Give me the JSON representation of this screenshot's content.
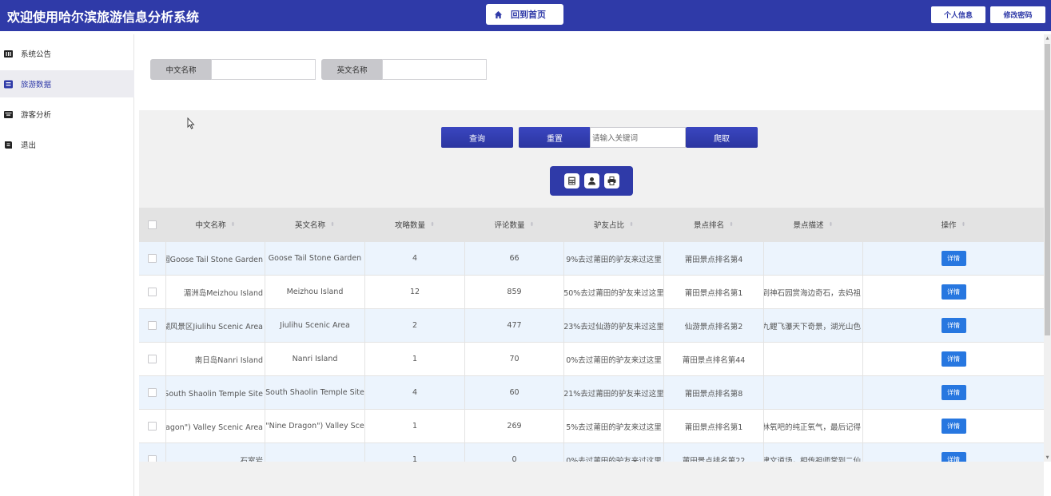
{
  "header": {
    "title": "欢迎使用哈尔滨旅游信息分析系统",
    "home_label": "回到首页",
    "profile_label": "个人信息",
    "password_label": "修改密码",
    "bg_color": "#2f3aa8"
  },
  "sidebar": {
    "items": [
      {
        "label": "系统公告",
        "icon": "notice-icon",
        "active": false
      },
      {
        "label": "旅游数据",
        "icon": "data-icon",
        "active": true
      },
      {
        "label": "游客分析",
        "icon": "analysis-icon",
        "active": false
      },
      {
        "label": "退出",
        "icon": "logout-icon",
        "active": false
      }
    ]
  },
  "search": {
    "cn_name_label": "中文名称",
    "en_name_label": "英文名称",
    "query_label": "查询",
    "reset_label": "重置",
    "keyword_placeholder": "请输入关键词",
    "crawl_label": "爬取"
  },
  "toolbar": {
    "icons": [
      "calculator-icon",
      "user-icon",
      "print-icon"
    ]
  },
  "table": {
    "columns": [
      "中文名称",
      "英文名称",
      "攻略数量",
      "评论数量",
      "驴友占比",
      "景点排名",
      "景点描述",
      "操作"
    ],
    "detail_label": "详情",
    "rows": [
      {
        "cn": "鹅尾神石园Goose Tail Stone Garden",
        "en": "Goose Tail Stone Garden",
        "guides": "4",
        "comments": "66",
        "ratio": "9%去过莆田的驴友来过这里",
        "rank": "莆田景点排名第4",
        "desc": ""
      },
      {
        "cn": "湄洲岛Meizhou Island",
        "en": "Meizhou Island",
        "guides": "12",
        "comments": "859",
        "ratio": "50%去过莆田的驴友来过这里",
        "rank": "莆田景点排名第1",
        "desc": "去湄洲岛，到神石园赏海边奇石，去妈祖"
      },
      {
        "cn": "九鲤湖风景区Jiulihu Scenic Area",
        "en": "Jiulihu Scenic Area",
        "guides": "2",
        "comments": "477",
        "ratio": "23%去过仙游的驴友来过这里",
        "rank": "仙游景点排名第2",
        "desc": "九鲤湖，赏九鲤飞瀑天下奇景，湖光山色"
      },
      {
        "cn": "南日岛Nanri Island",
        "en": "Nanri Island",
        "guides": "1",
        "comments": "70",
        "ratio": "0%去过莆田的驴友来过这里",
        "rank": "莆田景点排名第44",
        "desc": ""
      },
      {
        "cn": "南少林寺遗址South Shaolin Temple Site",
        "en": "South Shaolin Temple Site",
        "guides": "4",
        "comments": "60",
        "ratio": "21%去过莆田的驴友来过这里",
        "rank": "莆田景点排名第8",
        "desc": ""
      },
      {
        "cn": "九龙谷Jiulong (\"Nine Dragon\") Valley Scenic Area",
        "en": "Jiulong (\"Nine Dragon\") Valley Scenic Area",
        "guides": "1",
        "comments": "269",
        "ratio": "5%去过莆田的驴友来过这里",
        "rank": "莆田景点排名第1",
        "desc": "森林氧吧林氧吧的纯正氧气，最后记得"
      },
      {
        "cn": "石室岩",
        "en": "",
        "guides": "1",
        "comments": "0",
        "ratio": "0%去过莆田的驴友来过这里",
        "rank": "莆田景点排名第22",
        "desc": "创建文道场，相传祖师常到二仙"
      }
    ]
  }
}
